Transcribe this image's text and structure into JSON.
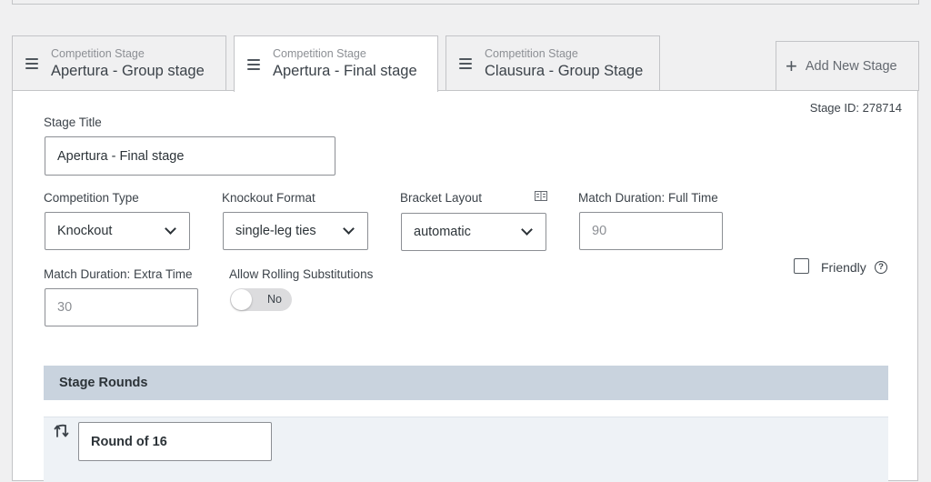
{
  "tabs": [
    {
      "subtitle": "Competition Stage",
      "title": "Apertura - Group stage"
    },
    {
      "subtitle": "Competition Stage",
      "title": "Apertura - Final stage"
    },
    {
      "subtitle": "Competition Stage",
      "title": "Clausura - Group Stage"
    }
  ],
  "add_stage": {
    "icon": "plus-icon",
    "label": "Add New Stage"
  },
  "stage": {
    "id_text": "Stage ID: 278714",
    "title_label": "Stage Title",
    "title_value": "Apertura - Final stage"
  },
  "fields": {
    "competition_type": {
      "label": "Competition Type",
      "value": "Knockout"
    },
    "knockout_format": {
      "label": "Knockout Format",
      "value": "single-leg ties"
    },
    "bracket_layout": {
      "label": "Bracket Layout",
      "value": "automatic",
      "icon": "bracket-layout-icon"
    },
    "full_time": {
      "label": "Match Duration: Full Time",
      "placeholder": "90"
    },
    "extra_time": {
      "label": "Match Duration: Extra Time",
      "placeholder": "30"
    },
    "rolling_subs": {
      "label": "Allow Rolling Substitutions",
      "toggle_text": "No"
    },
    "friendly": {
      "label": "Friendly",
      "help": "?"
    }
  },
  "rounds": {
    "header": "Stage Rounds",
    "items": [
      {
        "name": "Round of 16",
        "icon": "swap-icon"
      }
    ]
  },
  "colors": {
    "accent_header": "#c9d3de",
    "panel_bg": "#ffffff",
    "page_bg": "#f0f0f1"
  }
}
